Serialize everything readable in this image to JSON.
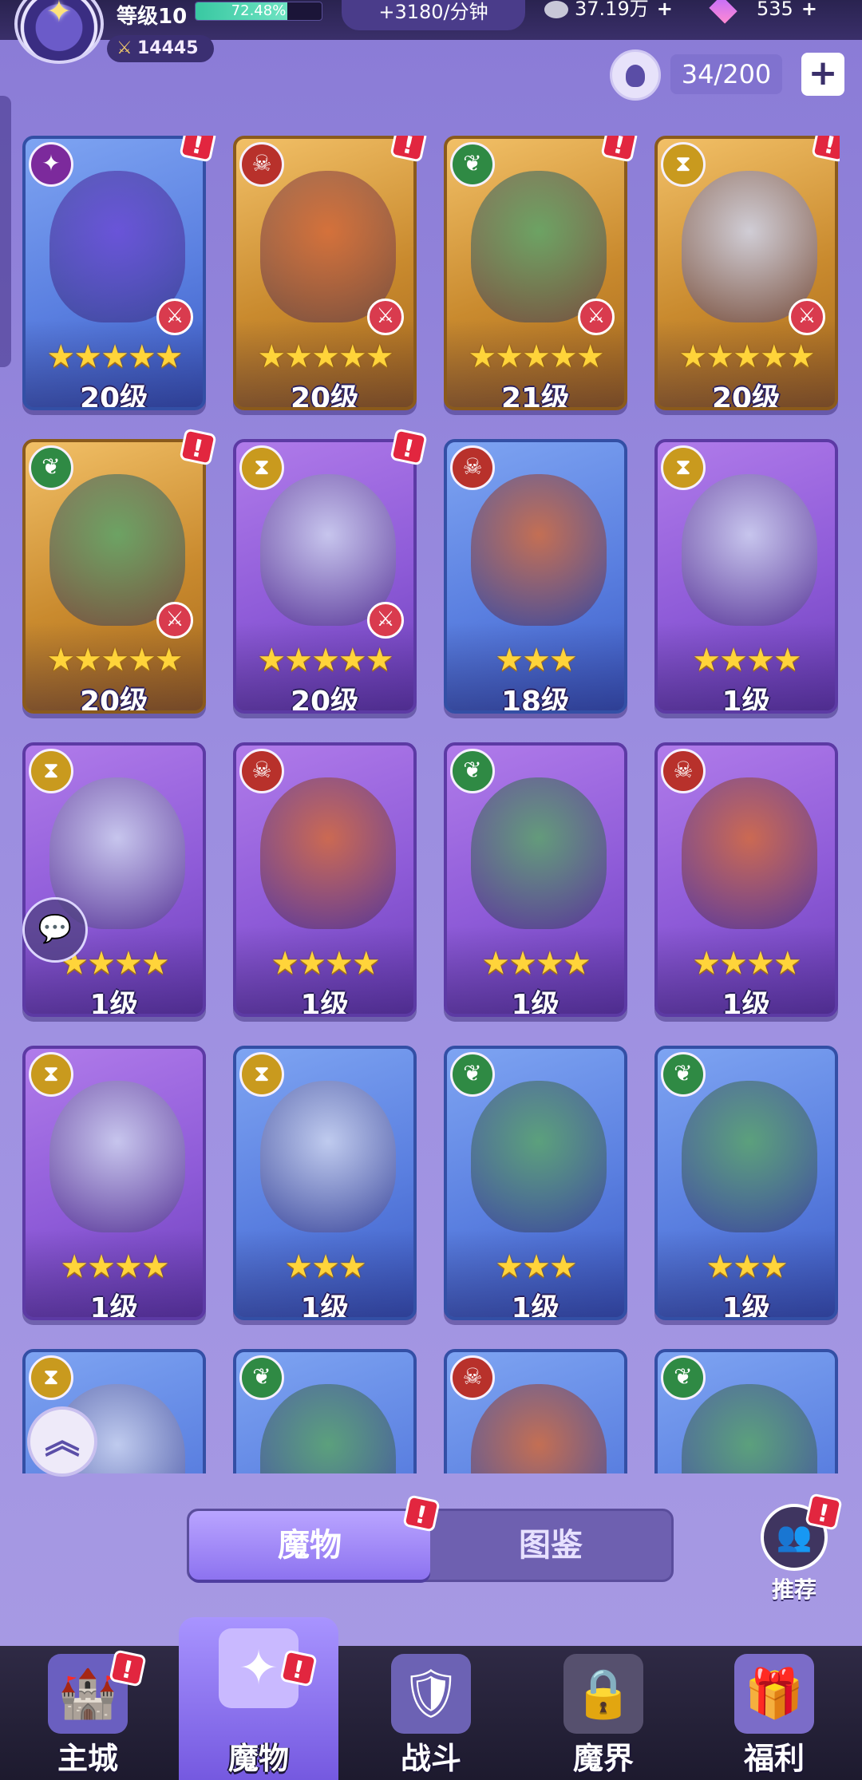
{
  "player": {
    "level_label": "等级10",
    "xp_percent": "72.48%",
    "xp_fraction": 0.7248,
    "power": "14445",
    "income_rate": "+3180/分钟",
    "coins": "37.19万",
    "gems": "535"
  },
  "capacity": {
    "text": "34/200",
    "plus": "+"
  },
  "monsters": [
    {
      "level": "20级",
      "stars": 5,
      "frame": "blue",
      "element": "void-icon",
      "banned": true,
      "alert": true
    },
    {
      "level": "20级",
      "stars": 5,
      "frame": "gold",
      "element": "fire-icon",
      "banned": true,
      "alert": true
    },
    {
      "level": "21级",
      "stars": 5,
      "frame": "gold",
      "element": "nature-icon",
      "banned": true,
      "alert": true
    },
    {
      "level": "20级",
      "stars": 5,
      "frame": "gold",
      "element": "time-icon",
      "banned": true,
      "alert": true
    },
    {
      "level": "20级",
      "stars": 5,
      "frame": "gold",
      "element": "nature-icon",
      "banned": true,
      "alert": true
    },
    {
      "level": "20级",
      "stars": 5,
      "frame": "purple",
      "element": "time-icon",
      "banned": true,
      "alert": true
    },
    {
      "level": "18级",
      "stars": 3,
      "frame": "blue",
      "element": "fire-icon",
      "banned": false,
      "alert": false
    },
    {
      "level": "1级",
      "stars": 4,
      "frame": "purple",
      "element": "time-icon",
      "banned": false,
      "alert": false
    },
    {
      "level": "1级",
      "stars": 4,
      "frame": "purple",
      "element": "time-icon",
      "banned": false,
      "alert": false
    },
    {
      "level": "1级",
      "stars": 4,
      "frame": "purple",
      "element": "fire-icon",
      "banned": false,
      "alert": false
    },
    {
      "level": "1级",
      "stars": 4,
      "frame": "purple",
      "element": "nature-icon",
      "banned": false,
      "alert": false
    },
    {
      "level": "1级",
      "stars": 4,
      "frame": "purple",
      "element": "fire-icon",
      "banned": false,
      "alert": false
    },
    {
      "level": "1级",
      "stars": 4,
      "frame": "purple",
      "element": "time-icon",
      "banned": false,
      "alert": false
    },
    {
      "level": "1级",
      "stars": 3,
      "frame": "blue",
      "element": "time-icon",
      "banned": false,
      "alert": false
    },
    {
      "level": "1级",
      "stars": 3,
      "frame": "blue",
      "element": "nature-icon",
      "banned": false,
      "alert": false
    },
    {
      "level": "1级",
      "stars": 3,
      "frame": "blue",
      "element": "nature-icon",
      "banned": false,
      "alert": false
    },
    {
      "level": "",
      "stars": 0,
      "frame": "blue",
      "element": "time-icon",
      "banned": false,
      "alert": false
    },
    {
      "level": "",
      "stars": 0,
      "frame": "blue",
      "element": "nature-icon",
      "banned": false,
      "alert": false
    },
    {
      "level": "",
      "stars": 0,
      "frame": "blue",
      "element": "fire-icon",
      "banned": false,
      "alert": false
    },
    {
      "level": "",
      "stars": 0,
      "frame": "blue",
      "element": "nature-icon",
      "banned": false,
      "alert": false
    }
  ],
  "tabs": {
    "monsters": "魔物",
    "codex": "图鉴"
  },
  "recommend_label": "推荐",
  "nav": [
    {
      "label": "主城",
      "icon": "castle-icon"
    },
    {
      "label": "魔物",
      "icon": "monster-flame-icon"
    },
    {
      "label": "战斗",
      "icon": "battle-shield-icon"
    },
    {
      "label": "魔界",
      "icon": "demon-realm-icon"
    },
    {
      "label": "福利",
      "icon": "reward-chest-icon"
    }
  ],
  "colors": {
    "background": "#9c8ee0",
    "alert": "#e2263f",
    "star": "#ffd43a",
    "active_tab": "#8d73f0"
  }
}
